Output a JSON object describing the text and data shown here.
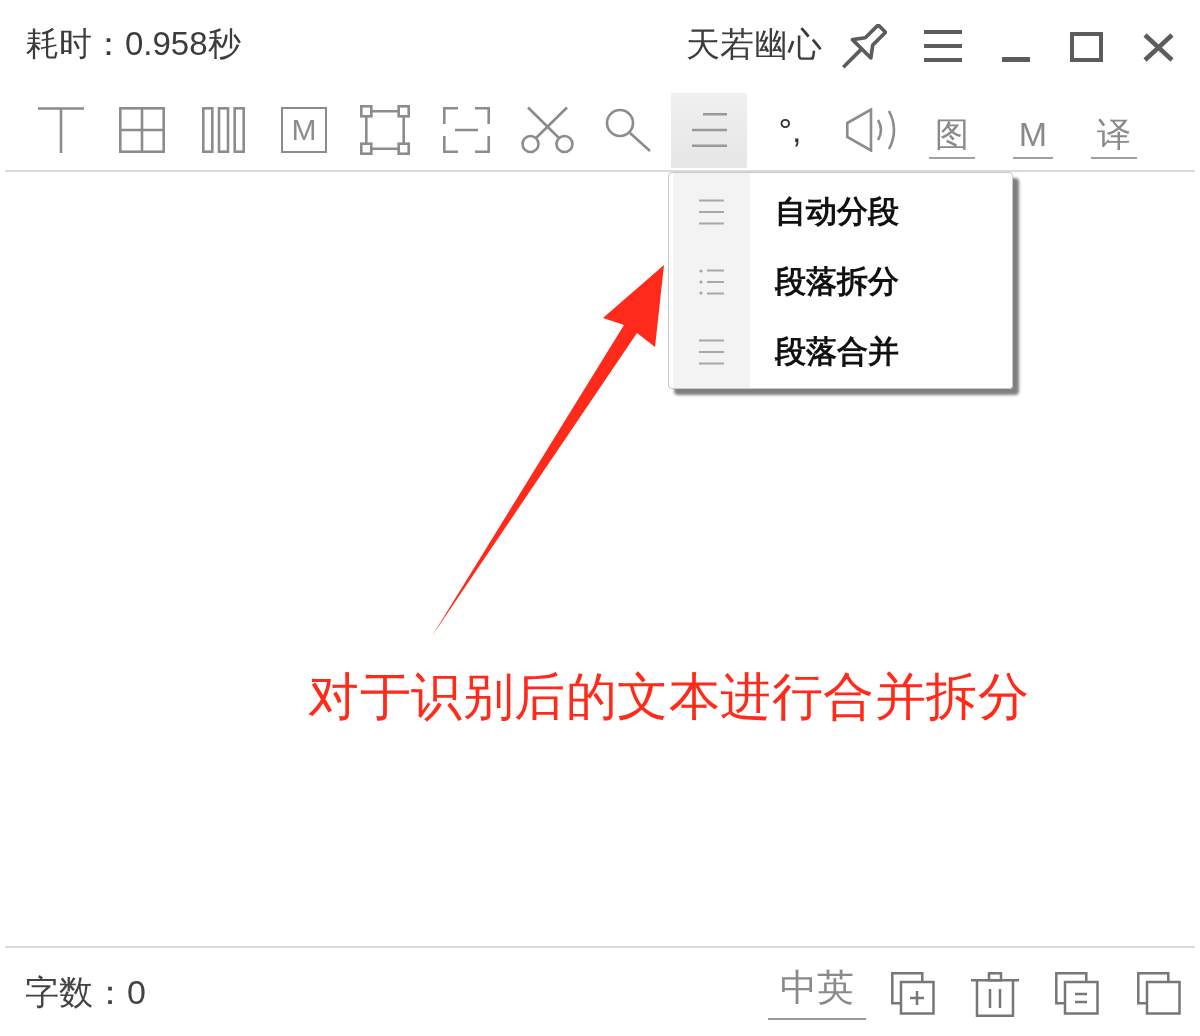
{
  "title_bar": {
    "elapsed": "耗时：0.958秒",
    "user_name": "天若幽心"
  },
  "toolbar": {
    "boxed_letter": "M",
    "paragraph_button": {
      "expanded": true
    },
    "punctuation": "°,",
    "text_buttons": [
      "图",
      "M",
      "译"
    ]
  },
  "paragraph_menu": {
    "items": [
      "自动分段",
      "段落拆分",
      "段落合并"
    ]
  },
  "annotation": {
    "text": "对于识别后的文本进行合并拆分"
  },
  "status_bar": {
    "word_count": "字数：0",
    "language_toggle": "中英"
  }
}
